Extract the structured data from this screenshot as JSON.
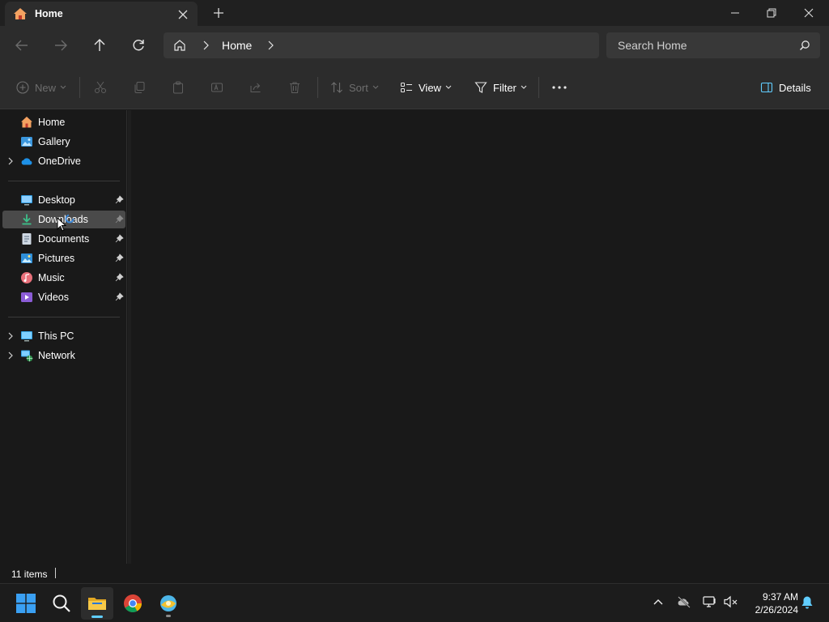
{
  "window": {
    "tab_title": "Home",
    "new_tab_symbol": "+"
  },
  "address": {
    "breadcrumb": "Home",
    "search_placeholder": "Search Home"
  },
  "commands": {
    "new": "New",
    "sort": "Sort",
    "view": "View",
    "filter": "Filter",
    "details": "Details"
  },
  "sidebar": {
    "top": [
      {
        "label": "Home",
        "icon": "home-icon"
      },
      {
        "label": "Gallery",
        "icon": "gallery-icon"
      },
      {
        "label": "OneDrive",
        "icon": "onedrive-icon"
      }
    ],
    "pinned": [
      {
        "label": "Desktop",
        "icon": "desktop-icon"
      },
      {
        "label": "Downloads",
        "icon": "downloads-icon"
      },
      {
        "label": "Documents",
        "icon": "documents-icon"
      },
      {
        "label": "Pictures",
        "icon": "pictures-icon"
      },
      {
        "label": "Music",
        "icon": "music-icon"
      },
      {
        "label": "Videos",
        "icon": "videos-icon"
      }
    ],
    "devices": [
      {
        "label": "This PC",
        "icon": "this-pc-icon"
      },
      {
        "label": "Network",
        "icon": "network-icon"
      }
    ]
  },
  "status": {
    "item_count": "11 items"
  },
  "taskbar": {
    "time": "9:37 AM",
    "date": "2/26/2024"
  },
  "colors": {
    "accent": "#60cdff",
    "background": "#191919",
    "panel": "#2c2c2c"
  }
}
